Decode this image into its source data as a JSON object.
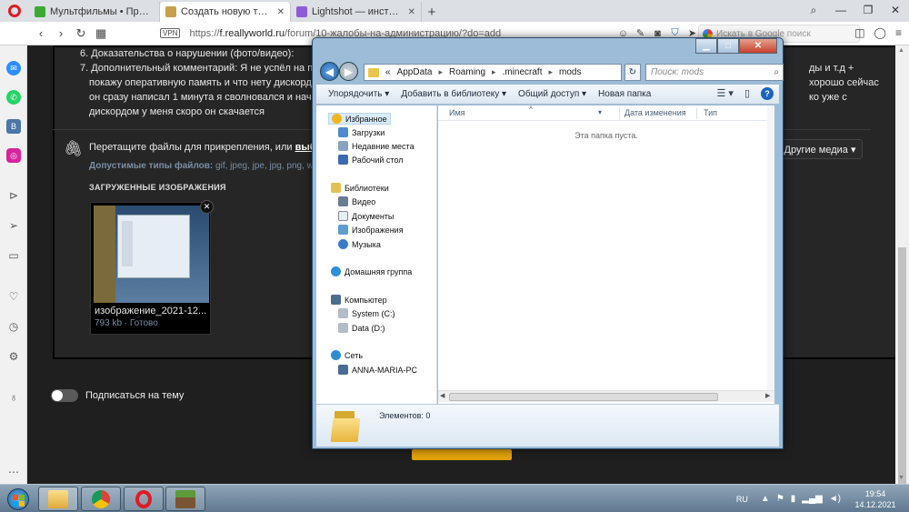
{
  "browser": {
    "tabs": [
      {
        "title": "Мультфильмы • Просмотр",
        "fav_color": "#3aaa35"
      },
      {
        "title": "Создать новую тему - Rea",
        "fav_color": "#c8a04a"
      },
      {
        "title": "Lightshot — инструмент сн",
        "fav_color": "#8f5bd8"
      }
    ],
    "new_tab": "+",
    "address": {
      "vpn": "VPN",
      "url_prefix": "https://",
      "url_domain": "f.reallyworld.ru",
      "url_path": "/forum/10-жалобы-на-администрацию/?do=add",
      "search_placeholder": "Искать в Google поиск"
    }
  },
  "page": {
    "line6": "6. Доказательства о нарушении (фото/видео):",
    "line7a": "7. Дополнительный комментарий: Я не успёл на пр",
    "line7a_end": "ды и т.д +",
    "line7b": "покажу оперативную память и что нету дискорд",
    "line7b_end": "хорошо сейчас",
    "line7c": "он сразу написал 1 минута я сволновался и нача",
    "line7c_end": "ко уже с",
    "line7d": "дискордом у меня скоро он скачается",
    "drop_text": "Перетащите файлы для прикрепления, или ",
    "drop_link": "выбе",
    "types_label": "Допустимые типы файлов:",
    "types_values": " gif, jpeg, jpe, jpg, png, w",
    "other_media": "Другие медиа ▾",
    "uploaded_title": "ЗАГРУЖЕННЫЕ ИЗОБРАЖЕНИЯ",
    "thumb_name": "изображение_2021-12...",
    "thumb_meta": "793 kb · Готово",
    "subscribe": "Подписаться на тему"
  },
  "explorer": {
    "breadcrumb": [
      "«",
      "AppData",
      "Roaming",
      ".minecraft",
      "mods"
    ],
    "search_placeholder": "Поиск: mods",
    "toolbar": [
      "Упорядочить ▾",
      "Добавить в библиотеку ▾",
      "Общий доступ ▾",
      "Новая папка"
    ],
    "nav": {
      "favorites": "Избранное",
      "downloads": "Загрузки",
      "recent": "Недавние места",
      "desktop": "Рабочий стол",
      "libraries": "Библиотеки",
      "video": "Видео",
      "documents": "Документы",
      "images": "Изображения",
      "music": "Музыка",
      "homegroup": "Домашняя группа",
      "computer": "Компьютер",
      "drive_c": "System (C:)",
      "drive_d": "Data (D:)",
      "network": "Сеть",
      "pc": "ANNA-MARIA-PC"
    },
    "columns": [
      "Имя",
      "Дата изменения",
      "Тип"
    ],
    "empty": "Эта папка пуста.",
    "status": "Элементов: 0"
  },
  "taskbar": {
    "lang": "RU",
    "time": "19:54",
    "date": "14.12.2021"
  }
}
